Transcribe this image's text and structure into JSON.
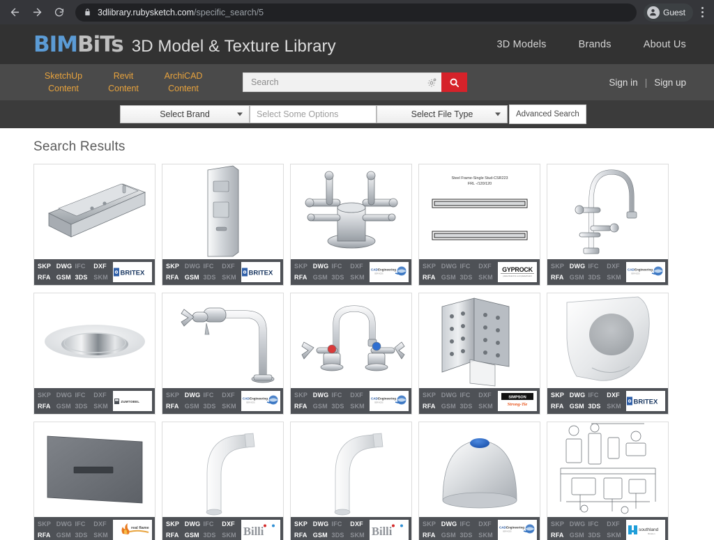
{
  "browser": {
    "back_label": "Back",
    "forward_label": "Forward",
    "reload_label": "Reload",
    "lock_icon": "lock-icon",
    "url_host": "3dlibrary.rubysketch.com",
    "url_path": "/specific_search/5",
    "profile_label": "Guest",
    "menu_icon": "kebab-menu-icon"
  },
  "header": {
    "logo_bim": "BIM",
    "logo_bits": "BiTs",
    "tagline": "3D Model & Texture Library",
    "nav": [
      {
        "label": "3D Models",
        "name": "nav-3d-models"
      },
      {
        "label": "Brands",
        "name": "nav-brands"
      },
      {
        "label": "About Us",
        "name": "nav-about-us"
      }
    ]
  },
  "utility": {
    "content_links": [
      {
        "line1": "SketchUp",
        "line2": "Content"
      },
      {
        "line1": "Revit",
        "line2": "Content"
      },
      {
        "line1": "ArchiCAD",
        "line2": "Content"
      }
    ],
    "search_placeholder": "Search",
    "search_value": "",
    "gear_icon": "gear-icon",
    "search_icon": "magnifier-icon",
    "sign_in": "Sign in",
    "separator": "|",
    "sign_up": "Sign up"
  },
  "filters": {
    "brand_label": "Select Brand",
    "options_placeholder": "Select Some Options",
    "filetype_label": "Select File Type",
    "advanced_label": "Advanced Search"
  },
  "results": {
    "title": "Search Results",
    "format_labels": [
      "SKP",
      "DWG",
      "IFC",
      "DXF",
      "RFA",
      "GSM",
      "3DS",
      "SKM"
    ],
    "colors": {
      "foot_bg": "#4e5156",
      "fmt_on": "#ffffff",
      "fmt_off": "#8d9096",
      "accent_red": "#d6222a",
      "accent_orange": "#e8a33d",
      "logo_blue": "#5b9bd5"
    },
    "cards": [
      {
        "name": "card-britex-trough",
        "thumb": "stainless-trough-sink",
        "formats": {
          "SKP": true,
          "DWG": true,
          "IFC": false,
          "DXF": true,
          "RFA": true,
          "GSM": true,
          "3DS": true,
          "SKM": false
        },
        "brand": "BRITEX",
        "brand_style": "britex"
      },
      {
        "name": "card-britex-panel",
        "thumb": "wall-panel-dispenser",
        "formats": {
          "SKP": true,
          "DWG": false,
          "IFC": false,
          "DXF": false,
          "RFA": true,
          "GSM": true,
          "3DS": false,
          "SKM": false
        },
        "brand": "BRITEX",
        "brand_style": "britex"
      },
      {
        "name": "card-cad-engineering-manifold",
        "thumb": "valve-manifold",
        "formats": {
          "SKP": false,
          "DWG": true,
          "IFC": false,
          "DXF": false,
          "RFA": true,
          "GSM": false,
          "3DS": false,
          "SKM": false
        },
        "brand": "CAD Engineering",
        "brand_style": "cadeng"
      },
      {
        "name": "card-gyprock-steel-frame",
        "thumb": "steel-frame-detail",
        "thumb_caption1": "Steel Frame-Single Stud-CSR223",
        "thumb_caption2": "FRL -/120/120",
        "formats": {
          "SKP": false,
          "DWG": false,
          "IFC": false,
          "DXF": false,
          "RFA": true,
          "GSM": false,
          "3DS": false,
          "SKM": false
        },
        "brand": "GYPROCK",
        "brand_sub": "Plasterboard its a art plasterboard",
        "brand_style": "gyprock"
      },
      {
        "name": "card-cad-engineering-tap-tall",
        "thumb": "gooseneck-lab-tap",
        "formats": {
          "SKP": false,
          "DWG": true,
          "IFC": false,
          "DXF": false,
          "RFA": true,
          "GSM": false,
          "3DS": false,
          "SKM": false
        },
        "brand": "CAD Engineering",
        "brand_style": "cadeng"
      },
      {
        "name": "card-zumtobel-downlight",
        "thumb": "recessed-downlight",
        "formats": {
          "SKP": false,
          "DWG": false,
          "IFC": false,
          "DXF": false,
          "RFA": true,
          "GSM": false,
          "3DS": false,
          "SKM": false
        },
        "brand": "ZUMTOBEL",
        "brand_style": "zumtobel"
      },
      {
        "name": "card-cad-engineering-swivel-tap",
        "thumb": "swivel-arm-tap",
        "formats": {
          "SKP": false,
          "DWG": true,
          "IFC": false,
          "DXF": false,
          "RFA": true,
          "GSM": false,
          "3DS": false,
          "SKM": false
        },
        "brand": "CAD Engineering",
        "brand_style": "cadeng"
      },
      {
        "name": "card-cad-engineering-mixer-tap",
        "thumb": "hot-cold-mixer-tap",
        "formats": {
          "SKP": false,
          "DWG": true,
          "IFC": false,
          "DXF": false,
          "RFA": true,
          "GSM": false,
          "3DS": false,
          "SKM": false
        },
        "brand": "CAD Engineering",
        "brand_style": "cadeng"
      },
      {
        "name": "card-simpson-strongtie-bracket",
        "thumb": "perforated-steel-bracket",
        "formats": {
          "SKP": false,
          "DWG": false,
          "IFC": false,
          "DXF": false,
          "RFA": true,
          "GSM": false,
          "3DS": false,
          "SKM": false
        },
        "brand": "SIMPSON",
        "brand_sub": "Strong-Tie",
        "brand_style": "simpson"
      },
      {
        "name": "card-britex-urinal",
        "thumb": "wall-urinal",
        "formats": {
          "SKP": true,
          "DWG": true,
          "IFC": false,
          "DXF": true,
          "RFA": true,
          "GSM": true,
          "3DS": true,
          "SKM": false
        },
        "brand": "BRITEX",
        "brand_style": "britex"
      },
      {
        "name": "card-real-flame-flush-plate",
        "thumb": "flush-plate",
        "formats": {
          "SKP": false,
          "DWG": false,
          "IFC": false,
          "DXF": false,
          "RFA": true,
          "GSM": false,
          "3DS": false,
          "SKM": false
        },
        "brand": "real flame",
        "brand_style": "realflame"
      },
      {
        "name": "card-billi-curved-tap-1",
        "thumb": "curved-spout-tap",
        "formats": {
          "SKP": true,
          "DWG": true,
          "IFC": false,
          "DXF": true,
          "RFA": true,
          "GSM": true,
          "3DS": false,
          "SKM": false
        },
        "brand": "Billi",
        "brand_style": "billi"
      },
      {
        "name": "card-billi-curved-tap-2",
        "thumb": "curved-spout-tap",
        "formats": {
          "SKP": true,
          "DWG": true,
          "IFC": false,
          "DXF": true,
          "RFA": true,
          "GSM": true,
          "3DS": false,
          "SKM": false
        },
        "brand": "Billi",
        "brand_style": "billi"
      },
      {
        "name": "card-cad-engineering-emergency-dome",
        "thumb": "dome-push-button",
        "formats": {
          "SKP": false,
          "DWG": true,
          "IFC": false,
          "DXF": false,
          "RFA": true,
          "GSM": false,
          "3DS": false,
          "SKM": false
        },
        "brand": "CAD Engineering",
        "brand_style": "cadeng"
      },
      {
        "name": "card-southland-filtration-schematic",
        "thumb": "filtration-schematic",
        "formats": {
          "SKP": false,
          "DWG": false,
          "IFC": false,
          "DXF": false,
          "RFA": true,
          "GSM": false,
          "3DS": false,
          "SKM": false
        },
        "brand": "southland",
        "brand_sub": "filtration",
        "brand_style": "southland"
      }
    ]
  }
}
